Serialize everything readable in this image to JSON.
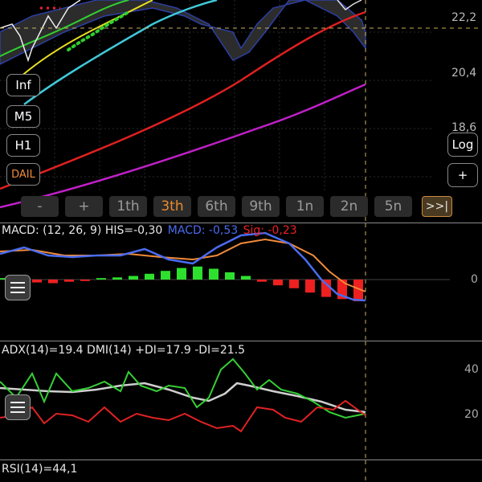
{
  "price_panel": {
    "price_labels": [
      "22,2",
      "20,4",
      "18,6"
    ],
    "left_buttons": [
      "Inf",
      "M5",
      "H1",
      "DAIL"
    ],
    "right_buttons": [
      "Log",
      "+"
    ],
    "timeframes": [
      "-",
      "+",
      "1th",
      "3th",
      "6th",
      "9th",
      "1n",
      "2n",
      "5n"
    ],
    "active_timeframe": "3th",
    "forward_button": ">>|"
  },
  "macd": {
    "title": "MACD: (12, 26, 9) HIS=-0,30",
    "macd_label": "MACD: -0,53",
    "sig_label": "Sig: -0,23",
    "zero_label": "0",
    "colors": {
      "macd": "#4a6cf0",
      "signal": "#f08a3a",
      "hist_pos": "#2ee02e",
      "hist_neg": "#ee2020"
    }
  },
  "adx": {
    "title": "ADX(14)=19.4  DMI(14) +DI=17.9  -DI=21.5",
    "axis_labels": [
      "40",
      "20"
    ],
    "colors": {
      "adx": "#cfcfcf",
      "plus_di": "#35d035",
      "minus_di": "#e02222"
    }
  },
  "rsi": {
    "title": "RSI(14)=44,1"
  },
  "menu_icon": "hamburger-menu-icon",
  "chart_data": [
    {
      "type": "line",
      "title": "",
      "series": [
        {
          "values": [
            22.6,
            22.9,
            23.1,
            23.5
          ]
        },
        {
          "values": [
            21.0,
            21.6,
            22.3,
            23.0
          ]
        },
        {
          "values": [
            19.8,
            20.6,
            21.5,
            22.2
          ]
        },
        {
          "values": [
            18.2,
            19.2,
            20.4,
            21.4
          ]
        },
        {
          "values": [
            17.6,
            18.4,
            19.2,
            19.9
          ]
        }
      ]
    },
    {
      "type": "bar",
      "title": "MACD: (12, 26, 9) HIS=-0,30",
      "histogram": [
        0.02,
        0.0,
        -0.04,
        -0.05,
        -0.03,
        -0.02,
        0.02,
        0.03,
        0.05,
        0.08,
        0.12,
        0.16,
        0.18,
        0.15,
        0.1,
        0.05,
        -0.03,
        -0.08,
        -0.12,
        -0.18,
        -0.24,
        -0.27,
        -0.3
      ]
    },
    {
      "type": "line",
      "title": "ADX(14)=19.4  DMI(14) +DI=17.9  -DI=21.5",
      "ylim": [
        15,
        45
      ]
    }
  ]
}
